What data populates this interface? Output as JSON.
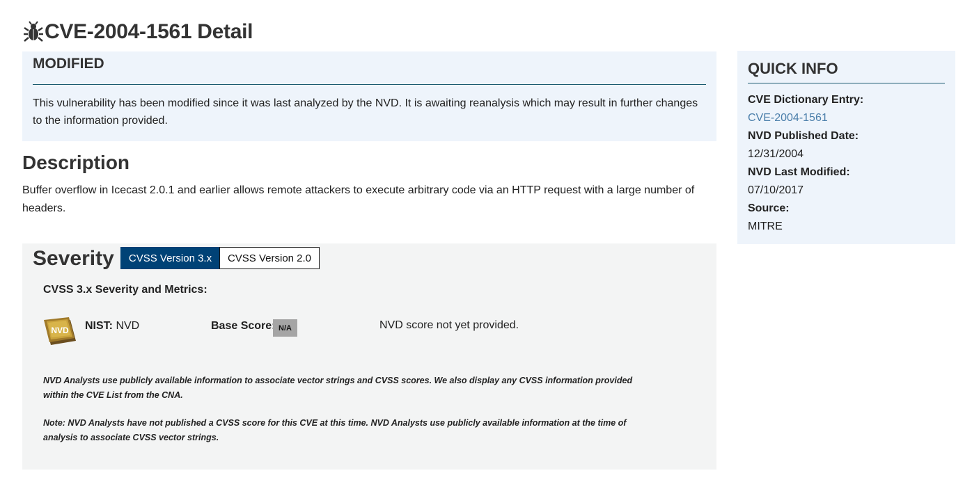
{
  "page": {
    "title": "CVE-2004-1561 Detail",
    "title_icon": "bug-icon"
  },
  "modified": {
    "heading": "MODIFIED",
    "text": "This vulnerability has been modified since it was last analyzed by the NVD. It is awaiting reanalysis which may result in further changes to the information provided."
  },
  "description": {
    "heading": "Description",
    "text": "Buffer overflow in Icecast 2.0.1 and earlier allows remote attackers to execute arbitrary code via an HTTP request with a large number of headers."
  },
  "severity": {
    "heading": "Severity",
    "tabs": [
      {
        "label": "CVSS Version 3.x",
        "active": true
      },
      {
        "label": "CVSS Version 2.0",
        "active": false
      }
    ],
    "metrics_heading": "CVSS 3.x Severity and Metrics:",
    "logo_text": "NVD",
    "nist_label": "NIST:",
    "nist_value": "NVD",
    "base_score_label": "Base Score:",
    "base_score_value": "N/A",
    "score_note": "NVD score not yet provided.",
    "note_1": "NVD Analysts use publicly available information to associate vector strings and CVSS scores. We also display any CVSS information provided within the CVE List from the CNA.",
    "note_2": "Note: NVD Analysts have not published a CVSS score for this CVE at this time. NVD Analysts use publicly available information at the time of analysis to associate CVSS vector strings."
  },
  "quick_info": {
    "heading": "QUICK INFO",
    "cve_entry_label": "CVE Dictionary Entry:",
    "cve_entry_value": "CVE-2004-1561",
    "published_label": "NVD Published Date:",
    "published_value": "12/31/2004",
    "modified_label": "NVD Last Modified:",
    "modified_value": "07/10/2017",
    "source_label": "Source:",
    "source_value": "MITRE"
  },
  "colors": {
    "active_tab": "#004276",
    "panel_bg": "#eef4fb",
    "severity_bg": "#f3f4f4",
    "link": "#4a7eaa",
    "badge": "#a5a5a5"
  }
}
